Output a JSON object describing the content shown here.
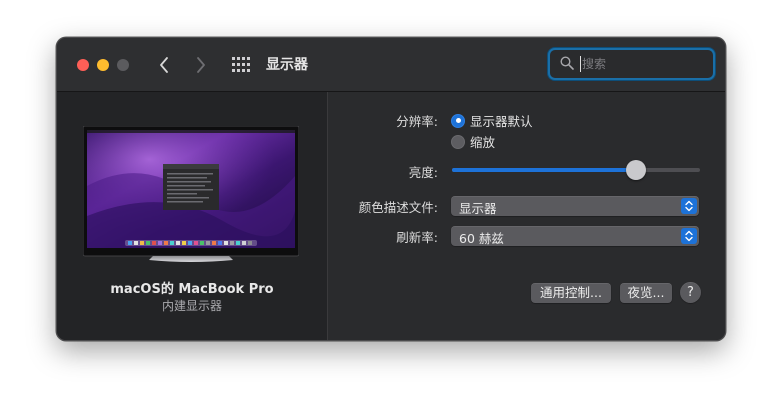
{
  "window": {
    "title": "显示器",
    "search": {
      "placeholder": "搜索",
      "value": ""
    }
  },
  "display": {
    "name": "macOS的 MacBook Pro",
    "subtitle": "内建显示器"
  },
  "settings": {
    "resolution": {
      "label": "分辨率:",
      "options": [
        {
          "label": "显示器默认",
          "selected": true
        },
        {
          "label": "缩放",
          "selected": false
        }
      ]
    },
    "brightness": {
      "label": "亮度:",
      "level_percent": 74
    },
    "color_profile": {
      "label": "颜色描述文件:",
      "value": "显示器"
    },
    "refresh_rate": {
      "label": "刷新率:",
      "value": "60 赫兹"
    }
  },
  "buttons": {
    "universal_control": "通用控制...",
    "night_shift": "夜览...",
    "help": "?"
  },
  "icons": {
    "back": "chevron-left-icon",
    "forward": "chevron-right-icon",
    "grid": "grid-icon",
    "search": "search-icon",
    "popup": "updown-chevron-icon"
  },
  "colors": {
    "accent": "#1d72d8",
    "close": "#fe5f57",
    "minimize": "#febc2e",
    "search_focus": "#1a6fa8"
  }
}
